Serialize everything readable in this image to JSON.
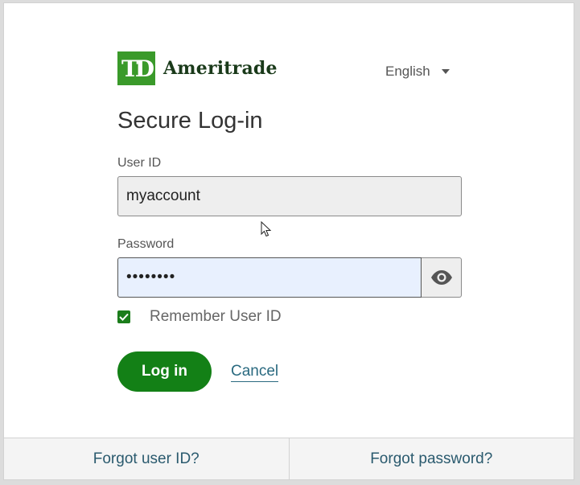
{
  "brand": {
    "logo_mark": "TD",
    "name": "Ameritrade",
    "logo_color": "#3a9a2a"
  },
  "language": {
    "selected": "English"
  },
  "form": {
    "title": "Secure Log-in",
    "userid_label": "User ID",
    "userid_value": "myaccount",
    "password_label": "Password",
    "password_value": "••••••••",
    "remember_label": "Remember User ID",
    "remember_checked": true,
    "login_label": "Log in",
    "cancel_label": "Cancel"
  },
  "footer": {
    "forgot_userid": "Forgot user ID?",
    "forgot_password": "Forgot password?"
  },
  "icons": {
    "show_password": "eye-icon",
    "checkbox": "checkmark-icon",
    "language_caret": "caret-down-icon",
    "pointer": "mouse-cursor-icon"
  },
  "colors": {
    "accent_green": "#138016",
    "link": "#2a6a80",
    "password_fill": "#e8f0fe"
  }
}
